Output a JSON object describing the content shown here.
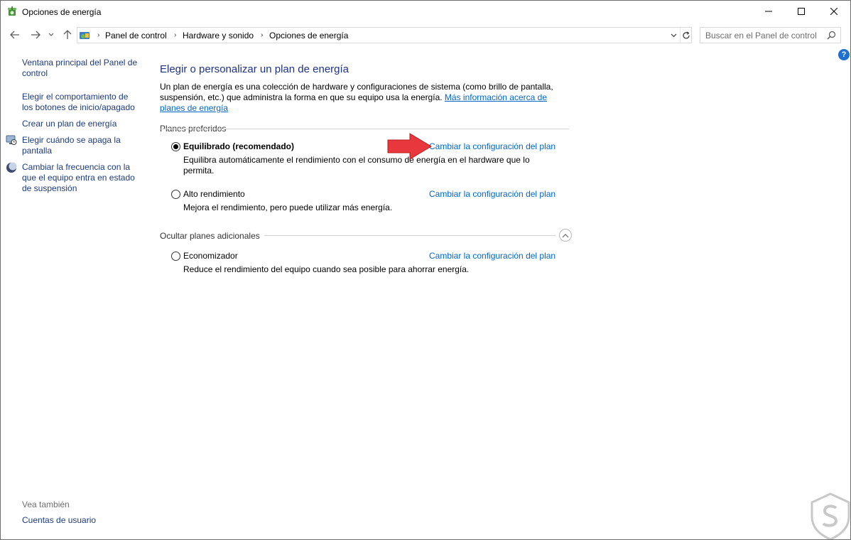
{
  "window": {
    "title": "Opciones de energía",
    "icon": "power-options-icon"
  },
  "address_bar": {
    "breadcrumbs": [
      "Panel de control",
      "Hardware y sonido",
      "Opciones de energía"
    ],
    "search_placeholder": "Buscar en el Panel de control"
  },
  "help": {
    "label": "?"
  },
  "sidebar": {
    "links": [
      {
        "label": "Ventana principal del Panel de control",
        "icon": ""
      },
      {
        "label": "Elegir el comportamiento de los botones de inicio/apagado",
        "icon": ""
      },
      {
        "label": "Crear un plan de energía",
        "icon": ""
      },
      {
        "label": "Elegir cuándo se apaga la pantalla",
        "icon": "monitor-clock-icon"
      },
      {
        "label": "Cambiar la frecuencia con la que el equipo entra en estado de suspensión",
        "icon": "moon-icon"
      }
    ],
    "see_also_heading": "Vea también",
    "see_also_links": [
      {
        "label": "Cuentas de usuario"
      }
    ]
  },
  "main": {
    "title": "Elegir o personalizar un plan de energía",
    "intro_text": "Un plan de energía es una colección de hardware y configuraciones de sistema (como brillo de pantalla, suspensión, etc.) que administra la forma en que su equipo usa la energía.",
    "intro_link": "Más información acerca de planes de energía",
    "preferred_heading": "Planes preferidos",
    "additional_heading": "Ocultar planes adicionales",
    "plans": [
      {
        "name": "Equilibrado (recomendado)",
        "selected": true,
        "description": "Equilibra automáticamente el rendimiento con el consumo de energía en el hardware que lo permita.",
        "link": "Cambiar la configuración del plan"
      },
      {
        "name": "Alto rendimiento",
        "selected": false,
        "description": "Mejora el rendimiento, pero puede utilizar más energía.",
        "link": "Cambiar la configuración del plan"
      },
      {
        "name": "Economizador",
        "selected": false,
        "description": "Reduce el rendimiento del equipo cuando sea posible para ahorrar energía.",
        "link": "Cambiar la configuración del plan"
      }
    ]
  },
  "colors": {
    "link": "#0066cc",
    "title": "#1e3287",
    "sidebar_link": "#1c3a7a",
    "arrow": "#e8383d"
  }
}
